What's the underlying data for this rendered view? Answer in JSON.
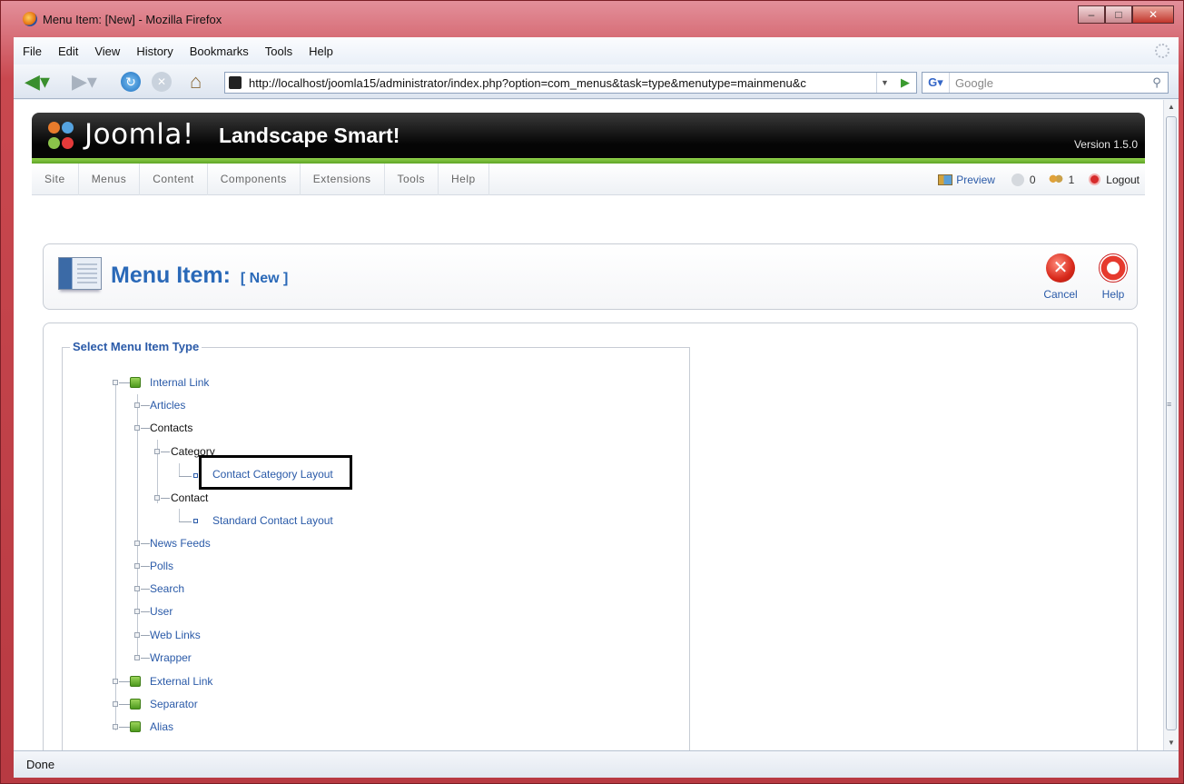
{
  "window": {
    "title": "Menu Item: [New] - Mozilla Firefox",
    "controls": [
      "minimize",
      "maximize",
      "close"
    ]
  },
  "browser": {
    "menubar": [
      "File",
      "Edit",
      "View",
      "History",
      "Bookmarks",
      "Tools",
      "Help"
    ],
    "url": "http://localhost/joomla15/administrator/index.php?option=com_menus&task=type&menutype=mainmenu&c",
    "search_placeholder": "Google",
    "status": "Done"
  },
  "joomla": {
    "logo_text": "Joomla!",
    "site_name": "Landscape Smart!",
    "version": "Version 1.5.0",
    "menu": [
      "Site",
      "Menus",
      "Content",
      "Components",
      "Extensions",
      "Tools",
      "Help"
    ],
    "preview_label": "Preview",
    "messages_count": "0",
    "users_count": "1",
    "logout_label": "Logout"
  },
  "toolbar": {
    "title": "Menu Item:",
    "subtitle": "[ New ]",
    "cancel_label": "Cancel",
    "help_label": "Help"
  },
  "tree": {
    "legend": "Select Menu Item Type",
    "internal_link": "Internal Link",
    "articles": "Articles",
    "contacts": "Contacts",
    "category": "Category",
    "contact_category_layout": "Contact Category Layout",
    "contact": "Contact",
    "standard_contact_layout": "Standard Contact Layout",
    "news_feeds": "News Feeds",
    "polls": "Polls",
    "search": "Search",
    "user": "User",
    "web_links": "Web Links",
    "wrapper": "Wrapper",
    "external_link": "External Link",
    "separator": "Separator",
    "alias": "Alias"
  },
  "colors": {
    "titlebar": "#c9484f",
    "link": "#2a5aa8",
    "joomla_green": "#5fa427",
    "header_black": "#050505"
  }
}
